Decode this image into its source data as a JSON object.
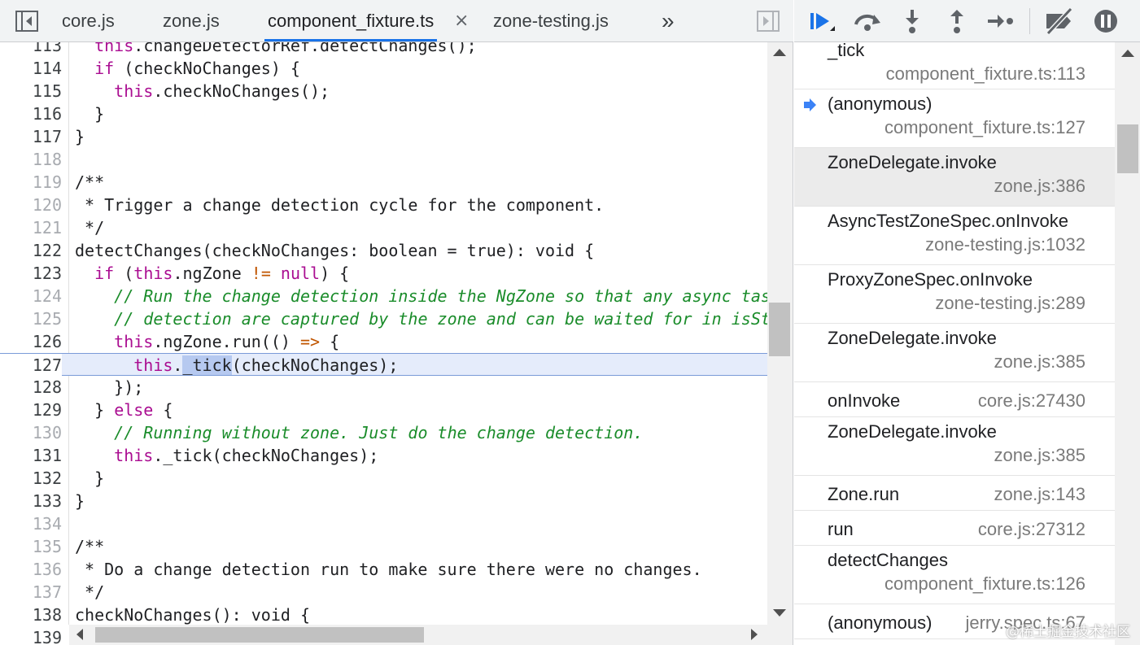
{
  "tabs": [
    {
      "label": "core.js",
      "active": false
    },
    {
      "label": "zone.js",
      "active": false
    },
    {
      "label": "component_fixture.ts",
      "active": true
    },
    {
      "label": "zone-testing.js",
      "active": false
    }
  ],
  "tab_close_glyph": "×",
  "tab_more_glyph": "»",
  "colors": {
    "accent": "#1a73e8",
    "keyword": "#aa0d91",
    "comment": "#1a8c2a",
    "exec_line": "#e5ecfb"
  },
  "code_lines": [
    {
      "n": "113",
      "dim": false,
      "segs": [
        [
          "kw",
          "this"
        ],
        [
          "",
          "."
        ],
        [
          "",
          "changeDetectorRef.detectChanges();"
        ]
      ],
      "indent": "  "
    },
    {
      "n": "114",
      "dim": false,
      "indent": "  ",
      "segs": [
        [
          "kw",
          "if"
        ],
        [
          "",
          " (checkNoChanges) {"
        ]
      ]
    },
    {
      "n": "115",
      "dim": false,
      "indent": "    ",
      "segs": [
        [
          "kw",
          "this"
        ],
        [
          "",
          ".checkNoChanges();"
        ]
      ]
    },
    {
      "n": "116",
      "dim": false,
      "indent": "  ",
      "segs": [
        [
          "",
          "}"
        ]
      ]
    },
    {
      "n": "117",
      "dim": false,
      "indent": "",
      "segs": [
        [
          "",
          "}"
        ]
      ]
    },
    {
      "n": "118",
      "dim": true,
      "indent": "",
      "segs": []
    },
    {
      "n": "119",
      "dim": true,
      "indent": "",
      "segs": [
        [
          "",
          "/**"
        ]
      ]
    },
    {
      "n": "120",
      "dim": true,
      "indent": "",
      "segs": [
        [
          "",
          " * Trigger a change detection cycle for the component."
        ]
      ]
    },
    {
      "n": "121",
      "dim": true,
      "indent": "",
      "segs": [
        [
          "",
          " */"
        ]
      ]
    },
    {
      "n": "122",
      "dim": false,
      "indent": "",
      "segs": [
        [
          "",
          "detectChanges(checkNoChanges: boolean = true): void {"
        ]
      ]
    },
    {
      "n": "123",
      "dim": false,
      "indent": "  ",
      "segs": [
        [
          "kw",
          "if"
        ],
        [
          "",
          " ("
        ],
        [
          "kw",
          "this"
        ],
        [
          "",
          ".ngZone "
        ],
        [
          "op",
          "!="
        ],
        [
          "kw",
          " null"
        ],
        [
          "",
          ") {"
        ]
      ]
    },
    {
      "n": "124",
      "dim": true,
      "indent": "    ",
      "segs": [
        [
          "cm",
          "// Run the change detection inside the NgZone so that any async tasks as part of the change"
        ]
      ]
    },
    {
      "n": "125",
      "dim": true,
      "indent": "    ",
      "segs": [
        [
          "cm",
          "// detection are captured by the zone and can be waited for in isStable."
        ]
      ]
    },
    {
      "n": "126",
      "dim": false,
      "indent": "    ",
      "segs": [
        [
          "kw",
          "this"
        ],
        [
          "",
          ".ngZone.run(() "
        ],
        [
          "op",
          "=>"
        ],
        [
          "",
          " {"
        ]
      ]
    },
    {
      "n": "127",
      "dim": false,
      "indent": "      ",
      "exec": true,
      "segs": [
        [
          "kw",
          "this"
        ],
        [
          "",
          "."
        ],
        [
          "hl",
          "_tick"
        ],
        [
          "",
          "(checkNoChanges);"
        ]
      ]
    },
    {
      "n": "128",
      "dim": false,
      "indent": "    ",
      "segs": [
        [
          "",
          "});"
        ]
      ]
    },
    {
      "n": "129",
      "dim": false,
      "indent": "  ",
      "segs": [
        [
          "",
          "} "
        ],
        [
          "kw",
          "else"
        ],
        [
          "",
          " {"
        ]
      ]
    },
    {
      "n": "130",
      "dim": true,
      "indent": "    ",
      "segs": [
        [
          "cm",
          "// Running without zone. Just do the change detection."
        ]
      ]
    },
    {
      "n": "131",
      "dim": false,
      "indent": "    ",
      "segs": [
        [
          "kw",
          "this"
        ],
        [
          "",
          "._tick(checkNoChanges);"
        ]
      ]
    },
    {
      "n": "132",
      "dim": false,
      "indent": "  ",
      "segs": [
        [
          "",
          "}"
        ]
      ]
    },
    {
      "n": "133",
      "dim": false,
      "indent": "",
      "segs": [
        [
          "",
          "}"
        ]
      ]
    },
    {
      "n": "134",
      "dim": true,
      "indent": "",
      "segs": []
    },
    {
      "n": "135",
      "dim": true,
      "indent": "",
      "segs": [
        [
          "",
          "/**"
        ]
      ]
    },
    {
      "n": "136",
      "dim": true,
      "indent": "",
      "segs": [
        [
          "",
          " * Do a change detection run to make sure there were no changes."
        ]
      ]
    },
    {
      "n": "137",
      "dim": true,
      "indent": "",
      "segs": [
        [
          "",
          " */"
        ]
      ]
    },
    {
      "n": "138",
      "dim": false,
      "indent": "",
      "segs": [
        [
          "",
          "checkNoChanges(): void {"
        ]
      ]
    },
    {
      "n": "139",
      "dim": false,
      "indent": "",
      "segs": []
    }
  ],
  "debug_toolbar": [
    {
      "name": "resume-button",
      "icon": "resume-icon"
    },
    {
      "name": "step-over-button",
      "icon": "step-over-icon"
    },
    {
      "name": "step-into-button",
      "icon": "step-into-icon"
    },
    {
      "name": "step-out-button",
      "icon": "step-out-icon"
    },
    {
      "name": "step-button",
      "icon": "step-icon"
    },
    {
      "name": "deactivate-breakpoints-button",
      "icon": "deactivate-breakpoints-icon"
    },
    {
      "name": "pause-on-exceptions-button",
      "icon": "pause-on-exceptions-icon"
    }
  ],
  "call_stack": [
    {
      "fn": "_tick",
      "loc": "component_fixture.ts:113",
      "layout": "two",
      "cut": true
    },
    {
      "fn": "(anonymous)",
      "loc": "component_fixture.ts:127",
      "layout": "two",
      "current": true
    },
    {
      "fn": "ZoneDelegate.invoke",
      "loc": "zone.js:386",
      "layout": "two",
      "selected": true
    },
    {
      "fn": "AsyncTestZoneSpec.onInvoke",
      "loc": "zone-testing.js:1032",
      "layout": "two"
    },
    {
      "fn": "ProxyZoneSpec.onInvoke",
      "loc": "zone-testing.js:289",
      "layout": "two"
    },
    {
      "fn": "ZoneDelegate.invoke",
      "loc": "zone.js:385",
      "layout": "two"
    },
    {
      "fn": "onInvoke",
      "loc": "core.js:27430",
      "layout": "one"
    },
    {
      "fn": "ZoneDelegate.invoke",
      "loc": "zone.js:385",
      "layout": "two"
    },
    {
      "fn": "Zone.run",
      "loc": "zone.js:143",
      "layout": "one"
    },
    {
      "fn": "run",
      "loc": "core.js:27312",
      "layout": "one"
    },
    {
      "fn": "detectChanges",
      "loc": "component_fixture.ts:126",
      "layout": "two"
    },
    {
      "fn": "(anonymous)",
      "loc": "jerry.spec.ts:67",
      "layout": "one"
    }
  ],
  "watermark": "@稀土掘金技术社区"
}
